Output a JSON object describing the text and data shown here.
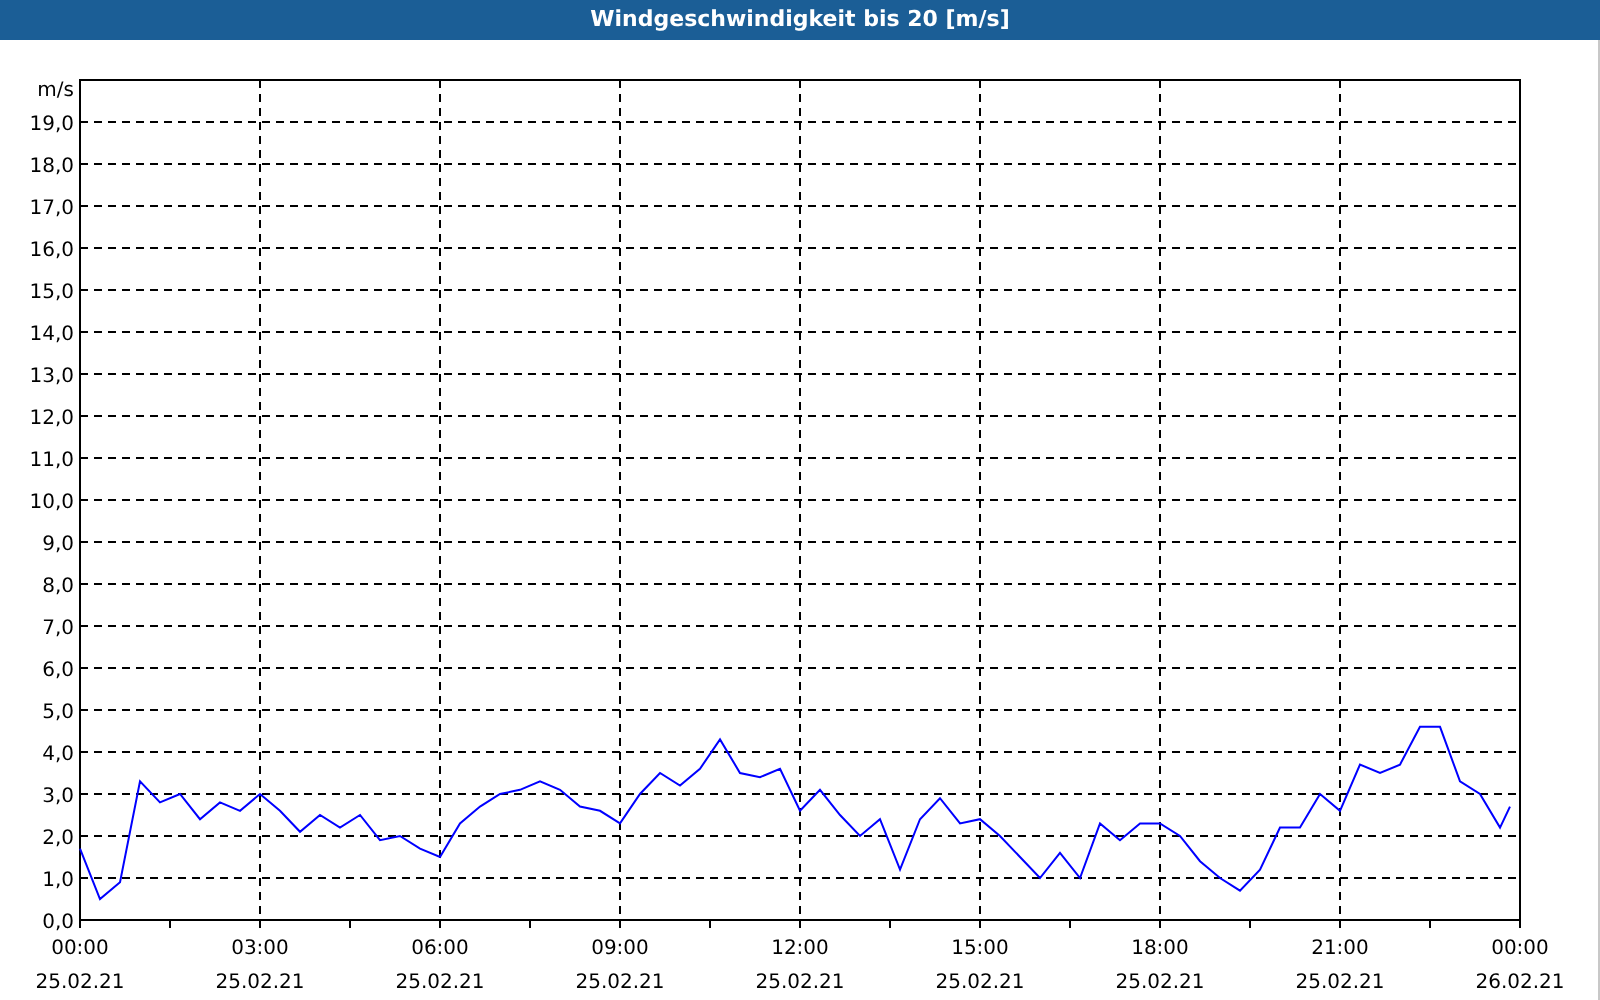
{
  "chart": {
    "date_labels": [
      "25.02.21",
      "25.02.21",
      "25.02.21",
      "25.02.21",
      "25.02.21",
      "25.02.21",
      "25.02.21",
      "25.02.21",
      "26.02.21"
    ],
    "chart_data": {
      "type": "line",
      "title": "Windgeschwindigkeit bis 20 [m/s]",
      "ylabel": "m/s",
      "xlim": [
        0,
        24
      ],
      "ylim": [
        0,
        20
      ],
      "x": [
        0,
        0.333,
        0.667,
        1,
        1.333,
        1.667,
        2,
        2.333,
        2.667,
        3,
        3.333,
        3.667,
        4,
        4.333,
        4.667,
        5,
        5.333,
        5.667,
        6,
        6.333,
        6.667,
        7,
        7.333,
        7.667,
        8,
        8.333,
        8.667,
        9,
        9.333,
        9.667,
        10,
        10.333,
        10.667,
        11,
        11.333,
        11.667,
        12,
        12.333,
        12.667,
        13,
        13.333,
        13.667,
        14,
        14.333,
        14.667,
        15,
        15.333,
        15.667,
        16,
        16.333,
        16.667,
        17,
        17.333,
        17.667,
        18,
        18.333,
        18.667,
        19,
        19.333,
        19.667,
        20,
        20.333,
        20.667,
        21,
        21.333,
        21.667,
        22,
        22.333,
        22.667,
        23,
        23.333,
        23.667,
        23.833
      ],
      "grid": true,
      "series": [
        {
          "color": "#0000ff",
          "values": [
            1.7,
            0.5,
            0.9,
            3.3,
            2.8,
            3.0,
            2.4,
            2.8,
            2.6,
            3.0,
            2.6,
            2.1,
            2.5,
            2.2,
            2.5,
            1.9,
            2.0,
            1.7,
            1.5,
            2.3,
            2.7,
            3.0,
            3.1,
            3.3,
            3.1,
            2.7,
            2.6,
            2.3,
            3.0,
            3.5,
            3.2,
            3.6,
            4.3,
            3.5,
            3.4,
            3.6,
            2.6,
            3.1,
            2.5,
            2.0,
            2.4,
            1.2,
            2.4,
            2.9,
            2.3,
            2.4,
            2.0,
            1.5,
            1.0,
            1.6,
            1.0,
            2.3,
            1.9,
            2.3,
            2.3,
            2.0,
            1.4,
            1.0,
            0.7,
            1.2,
            2.2,
            2.2,
            3.0,
            2.6,
            3.7,
            3.5,
            3.7,
            4.6,
            4.6,
            3.3,
            3.0,
            2.2,
            2.7
          ]
        }
      ],
      "xticks": [
        {
          "value": 0,
          "label": "00:00"
        },
        {
          "value": 3,
          "label": "03:00"
        },
        {
          "value": 6,
          "label": "06:00"
        },
        {
          "value": 9,
          "label": "09:00"
        },
        {
          "value": 12,
          "label": "12:00"
        },
        {
          "value": 15,
          "label": "15:00"
        },
        {
          "value": 18,
          "label": "18:00"
        },
        {
          "value": 21,
          "label": "21:00"
        },
        {
          "value": 24,
          "label": "00:00"
        }
      ],
      "yticks": [
        {
          "value": 0,
          "label": "0,0"
        },
        {
          "value": 1,
          "label": "1,0"
        },
        {
          "value": 2,
          "label": "2,0"
        },
        {
          "value": 3,
          "label": "3,0"
        },
        {
          "value": 4,
          "label": "4,0"
        },
        {
          "value": 5,
          "label": "5,0"
        },
        {
          "value": 6,
          "label": "6,0"
        },
        {
          "value": 7,
          "label": "7,0"
        },
        {
          "value": 8,
          "label": "8,0"
        },
        {
          "value": 9,
          "label": "9,0"
        },
        {
          "value": 10,
          "label": "10,0"
        },
        {
          "value": 11,
          "label": "11,0"
        },
        {
          "value": 12,
          "label": "12,0"
        },
        {
          "value": 13,
          "label": "13,0"
        },
        {
          "value": 14,
          "label": "14,0"
        },
        {
          "value": 15,
          "label": "15,0"
        },
        {
          "value": 16,
          "label": "16,0"
        },
        {
          "value": 17,
          "label": "17,0"
        },
        {
          "value": 18,
          "label": "18,0"
        },
        {
          "value": 19,
          "label": "19,0"
        }
      ]
    }
  }
}
